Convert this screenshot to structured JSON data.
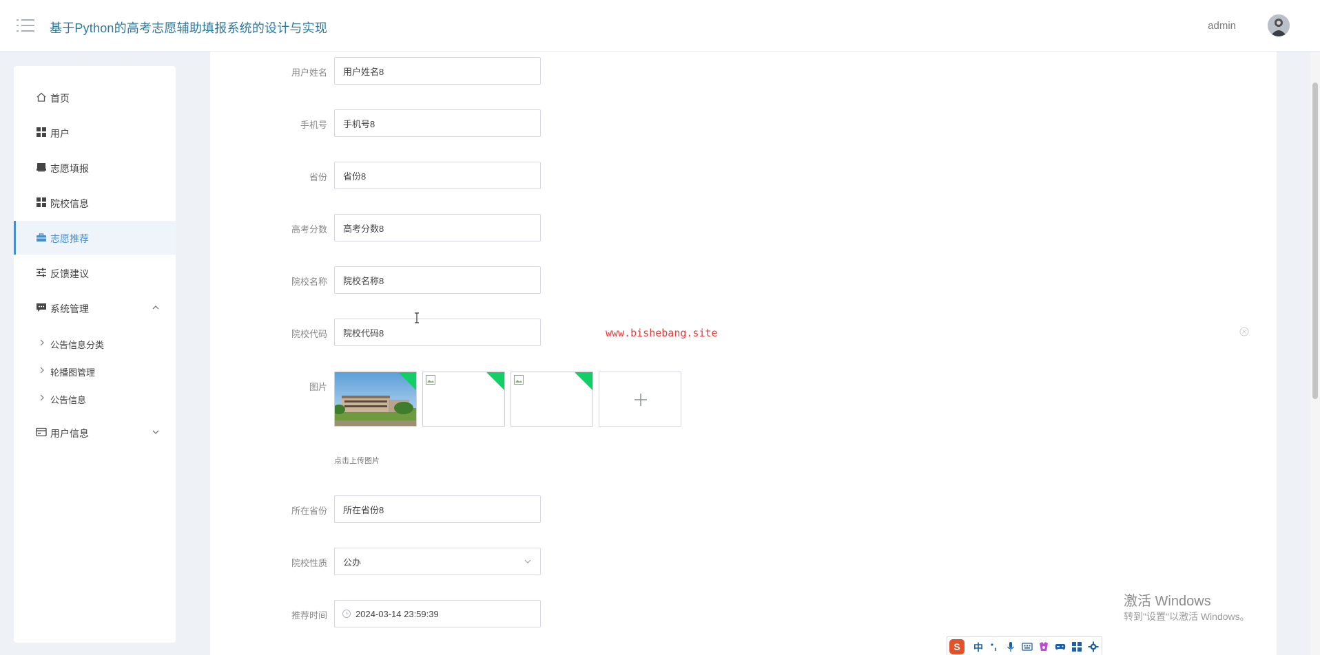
{
  "header": {
    "title": "基于Python的高考志愿辅助填报系统的设计与实现",
    "username": "admin"
  },
  "sidebar": {
    "items": [
      {
        "label": "首页",
        "icon": "home-icon"
      },
      {
        "label": "用户",
        "icon": "grid-icon"
      },
      {
        "label": "志愿填报",
        "icon": "tray-icon"
      },
      {
        "label": "院校信息",
        "icon": "grid-icon"
      },
      {
        "label": "志愿推荐",
        "icon": "briefcase-icon",
        "active": true
      },
      {
        "label": "反馈建议",
        "icon": "sliders-icon"
      },
      {
        "label": "系统管理",
        "icon": "chat-icon",
        "expanded": true
      },
      {
        "label": "用户信息",
        "icon": "card-icon",
        "expanded": false
      }
    ],
    "subitems": [
      {
        "label": "公告信息分类"
      },
      {
        "label": "轮播图管理"
      },
      {
        "label": "公告信息"
      }
    ]
  },
  "form": {
    "fields": [
      {
        "label": "用户姓名",
        "value": "用户姓名8"
      },
      {
        "label": "手机号",
        "value": "手机号8"
      },
      {
        "label": "省份",
        "value": "省份8"
      },
      {
        "label": "高考分数",
        "value": "高考分数8"
      },
      {
        "label": "院校名称",
        "value": "院校名称8"
      },
      {
        "label": "院校代码",
        "value": "院校代码8"
      }
    ],
    "picture": {
      "label": "图片",
      "hint": "点击上传图片"
    },
    "fields2": [
      {
        "label": "所在省份",
        "value": "所在省份8"
      },
      {
        "label": "院校性质",
        "value": "公办"
      },
      {
        "label": "推荐时间",
        "value": "2024-03-14 23:59:39"
      }
    ]
  },
  "watermark": "www.bishebang.site",
  "windows_notice": {
    "title": "激活 Windows",
    "subtitle": "转到\"设置\"以激活 Windows。"
  },
  "ime": {
    "mode": "中",
    "logo": "S"
  },
  "colors": {
    "accent": "#4a90c8",
    "title": "#2c7a9e",
    "corner_badge": "#13ce66",
    "watermark": "#e63b3b"
  }
}
